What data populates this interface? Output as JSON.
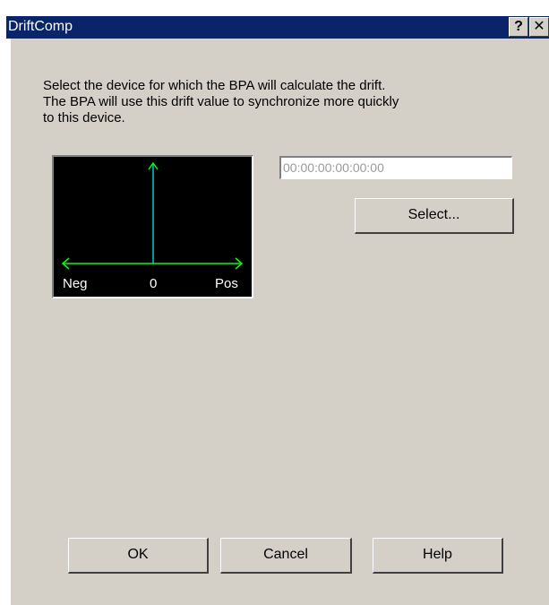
{
  "window": {
    "title": "DriftComp",
    "help_label": "?",
    "close_label": "✕"
  },
  "description": {
    "line1": "Select the device for which the BPA will calculate the drift.",
    "line2": "The BPA will use this drift value to synchronize more quickly",
    "line3": "to this device."
  },
  "drift_scope": {
    "neg_label": "Neg",
    "zero_label": "0",
    "pos_label": "Pos",
    "axis_color": "#00ff00",
    "needle_color": "#00cccc"
  },
  "device": {
    "address_placeholder": "00:00:00:00:00:00",
    "select_label": "Select..."
  },
  "buttons": {
    "ok": "OK",
    "cancel": "Cancel",
    "help": "Help"
  }
}
